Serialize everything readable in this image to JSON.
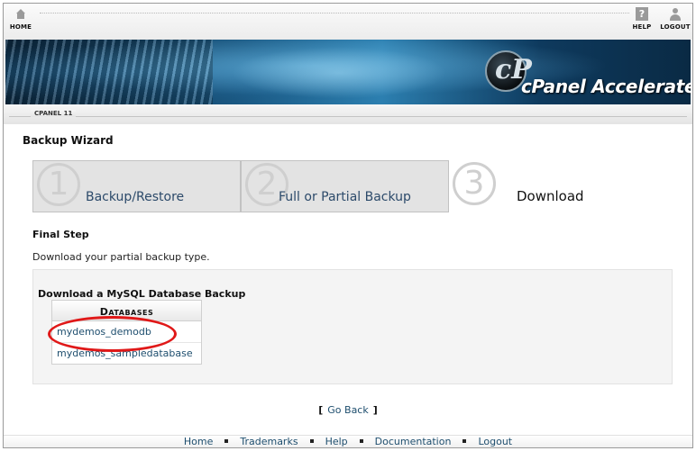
{
  "topnav": {
    "home_label": "HOME",
    "help_label": "HELP",
    "help_glyph": "?",
    "logout_label": "LOGOUT"
  },
  "banner": {
    "logo_glyph": "cP",
    "logo_text": "cPanel Accelerated"
  },
  "version_label": "CPANEL 11",
  "page_title": "Backup Wizard",
  "steps": [
    {
      "number": "1",
      "label": "Backup/Restore",
      "state": "done"
    },
    {
      "number": "2",
      "label": "Full or Partial Backup",
      "state": "done"
    },
    {
      "number": "3",
      "label": "Download",
      "state": "current"
    }
  ],
  "final_step": {
    "title": "Final Step",
    "description": "Download your partial backup type."
  },
  "panel": {
    "title": "Download a MySQL Database Backup",
    "table_header": "Databases",
    "databases": [
      "mydemos_demodb",
      "mydemos_sampledatabase"
    ]
  },
  "go_back": {
    "open": "[",
    "label": "Go Back",
    "close": "]"
  },
  "footer": {
    "links": [
      "Home",
      "Trademarks",
      "Help",
      "Documentation",
      "Logout"
    ]
  },
  "colors": {
    "link": "#1e4e6e",
    "highlight": "#e01818"
  }
}
